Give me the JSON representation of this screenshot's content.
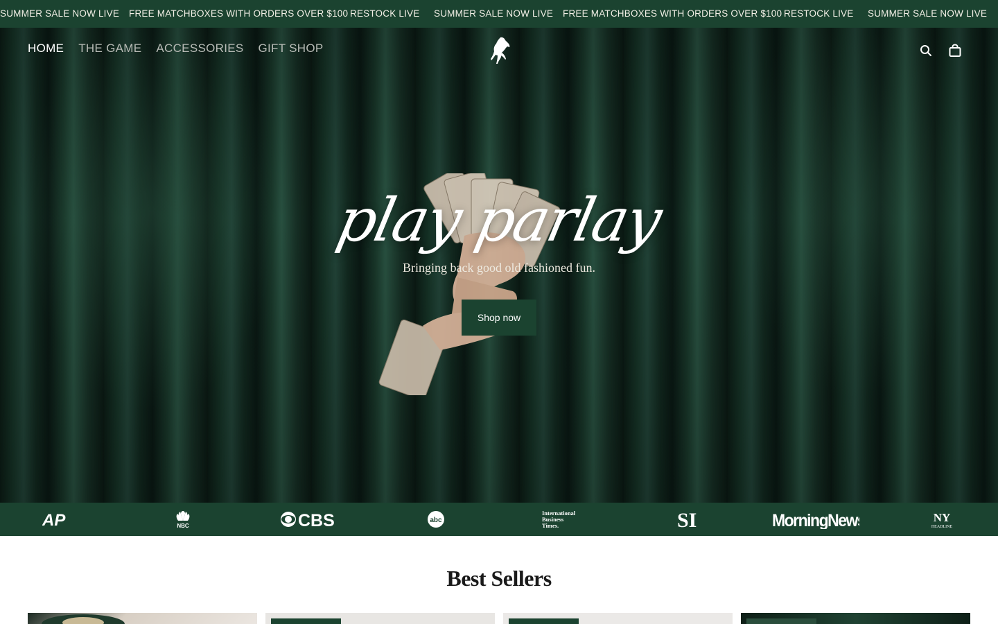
{
  "announcement": {
    "items": [
      "SUMMER SALE NOW LIVE",
      "FREE MATCHBOXES WITH ORDERS OVER $100",
      "RESTOCK LIVE",
      "SUMMER SALE NOW LIVE",
      "FREE MATCHBOXES WITH ORDERS OVER $100",
      "RESTOCK LIVE",
      "SUMMER SALE NOW LIVE"
    ]
  },
  "nav": {
    "items": [
      {
        "label": "HOME",
        "active": true
      },
      {
        "label": "THE GAME",
        "active": false
      },
      {
        "label": "ACCESSORIES",
        "active": false
      },
      {
        "label": "GIFT SHOP",
        "active": false
      }
    ]
  },
  "header": {
    "logo_icon": "rearing-horse-logo",
    "search_icon": "search-icon",
    "cart_icon": "shopping-bag-icon"
  },
  "hero": {
    "title": "play parlay",
    "subtitle": "Bringing back good old fashioned fun.",
    "cta_label": "Shop now"
  },
  "press": {
    "logos": [
      {
        "name": "AP",
        "icon": "ap-logo"
      },
      {
        "name": "NBC",
        "icon": "nbc-peacock-logo"
      },
      {
        "name": "CBS",
        "icon": "cbs-eye-logo"
      },
      {
        "name": "abc",
        "icon": "abc-logo"
      },
      {
        "name": "International Business Times",
        "icon": "ibt-logo"
      },
      {
        "name": "SI",
        "icon": "si-logo"
      },
      {
        "name": "MorningNews",
        "icon": "morningnews-logo"
      },
      {
        "name": "NY HEADLINE",
        "icon": "ny-headline-logo"
      }
    ]
  },
  "best_sellers": {
    "title": "Best Sellers"
  },
  "colors": {
    "brand_green": "#1b4330",
    "hero_dark": "#0c1c16",
    "text_dark": "#1a1a1a"
  }
}
